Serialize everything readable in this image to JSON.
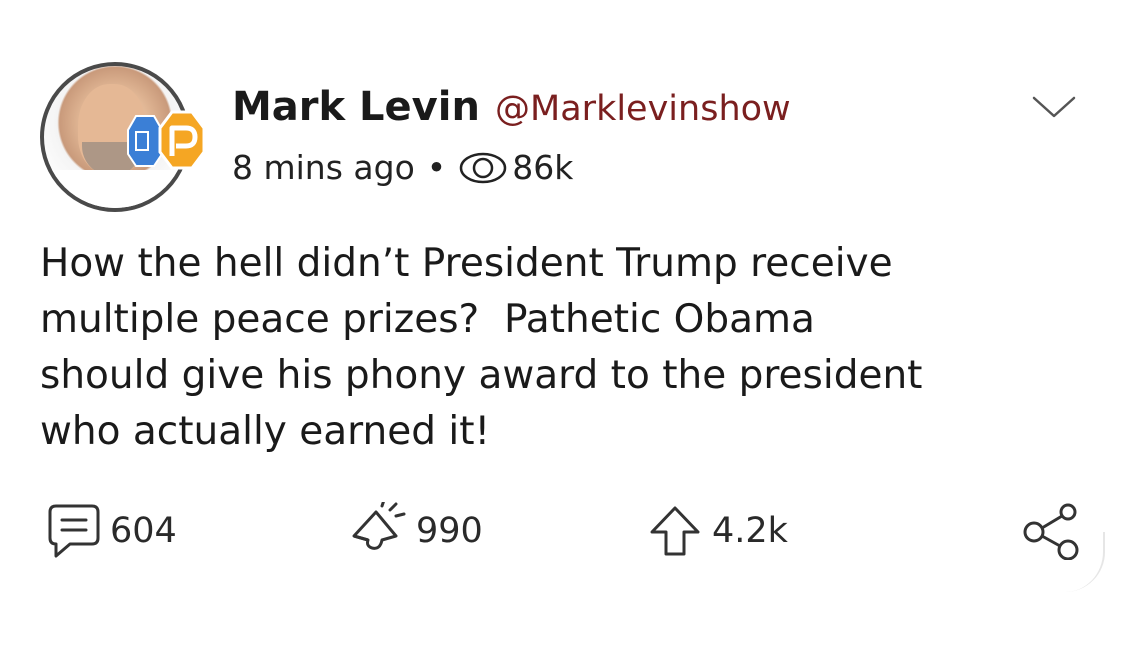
{
  "post": {
    "author_name": "Mark Levin",
    "author_handle": "@Marklevinshow",
    "timestamp": "8 mins ago",
    "separator": "•",
    "views": "86k",
    "body": "How the hell didn’t President Trump receive\nmultiple peace prizes?  Pathetic Obama\nshould give his phony award to the president\nwho actually earned it!"
  },
  "actions": {
    "comments": "604",
    "echoes": "990",
    "upvotes": "4.2k"
  },
  "icons": {
    "menu": "chevron-down-icon",
    "views": "eye-icon",
    "comment": "comment-icon",
    "echo": "megaphone-icon",
    "upvote": "arrow-up-icon",
    "share": "share-icon",
    "badge": "parler-badge-icon"
  },
  "colors": {
    "handle": "#7a1f1f",
    "badge_gold": "#f5a623",
    "badge_blue": "#3b7fd6"
  }
}
